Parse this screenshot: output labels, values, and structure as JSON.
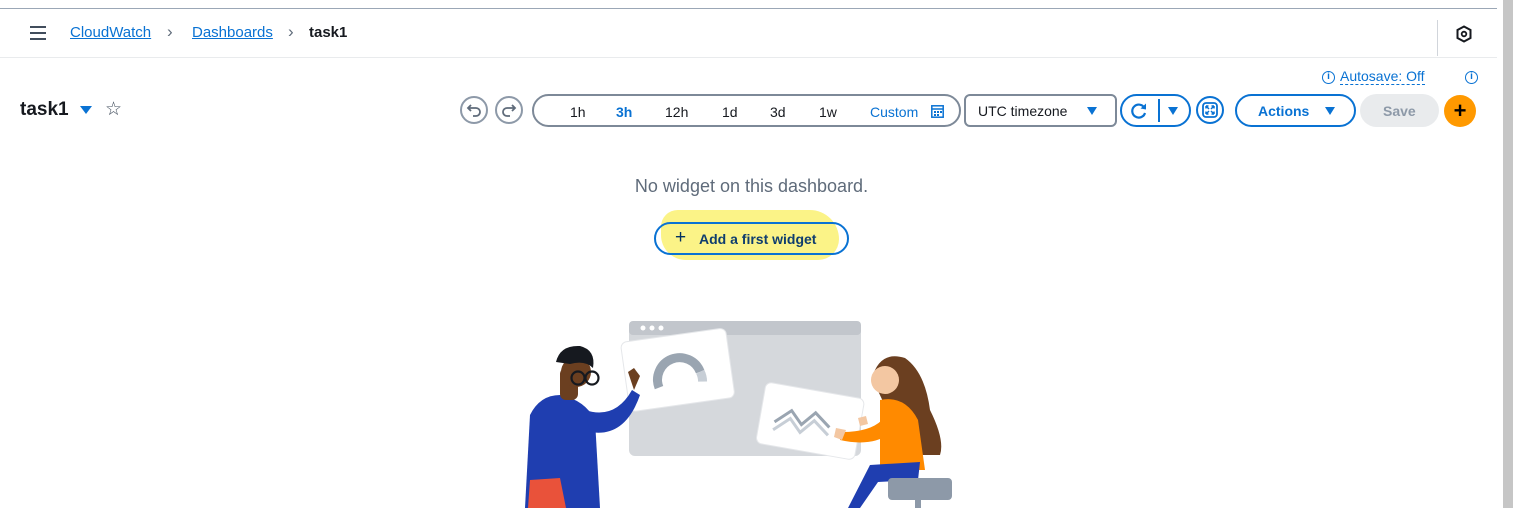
{
  "breadcrumb": {
    "items": [
      "CloudWatch",
      "Dashboards",
      "task1"
    ]
  },
  "dashboard": {
    "title": "task1"
  },
  "time_range": {
    "options": [
      "1h",
      "3h",
      "12h",
      "1d",
      "3d",
      "1w"
    ],
    "selected": "3h",
    "custom_label": "Custom"
  },
  "timezone": {
    "selected": "UTC timezone"
  },
  "autosave": {
    "label": "Autosave: Off"
  },
  "toolbar": {
    "actions_label": "Actions",
    "save_label": "Save",
    "add_label": "+"
  },
  "empty_state": {
    "message": "No widget on this dashboard.",
    "add_widget_label": "Add a first widget"
  },
  "colors": {
    "accent": "#0972d3",
    "add_button": "#ff9900",
    "highlight": "#fbf27a"
  },
  "icons": [
    "menu-icon",
    "hexagon-icon",
    "star-icon",
    "undo-icon",
    "redo-icon",
    "calendar-icon",
    "refresh-icon",
    "fullscreen-icon",
    "info-icon"
  ]
}
